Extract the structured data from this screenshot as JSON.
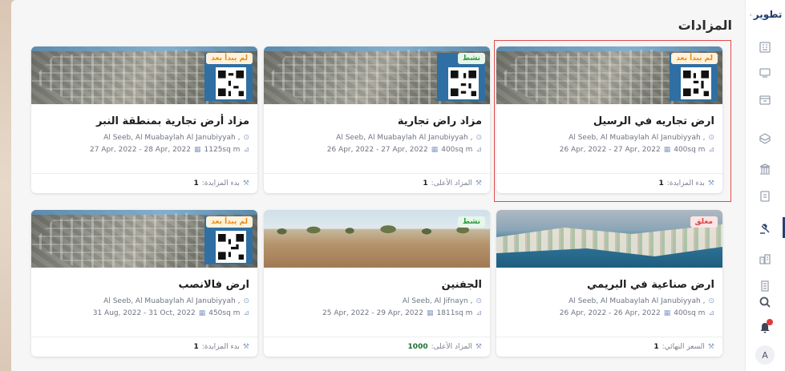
{
  "rail": {
    "brand": "تطوير",
    "notification_badge_color": "#e23b3b",
    "avatar_letter": "A",
    "icons": [
      "building-grid-icon",
      "monitor-icon",
      "screen-icon",
      "cube-icon",
      "bank-icon",
      "document-icon",
      "gavel-icon",
      "city-icon",
      "tower-icon",
      "search-icon",
      "bell-icon"
    ]
  },
  "page": {
    "title": "المزادات"
  },
  "cards": [
    {
      "title": "ارض تجاريه في الرسيل",
      "location": "Al Seeb, Al Muabaylah Al Janubiyyah ,",
      "area": "400sq m",
      "dates": "26 Apr, 2022 - 27 Apr, 2022",
      "status": "لم يبدأ بعد",
      "foot_label": "بدء المزايدة:",
      "foot_value": "1"
    },
    {
      "title": "مزاد راض تجارية",
      "location": "Al Seeb, Al Muabaylah Al Janubiyyah ,",
      "area": "400sq m",
      "dates": "26 Apr, 2022 - 27 Apr, 2022",
      "status": "نشط",
      "foot_label": "المزاد الأعلى:",
      "foot_value": "1"
    },
    {
      "title": "مزاد أرض تجارية بمنطقة النبر",
      "location": "Al Seeb, Al Muabaylah Al Janubiyyah ,",
      "area": "1125sq m",
      "dates": "27 Apr, 2022 - 28 Apr, 2022",
      "status": "لم يبدأ بعد",
      "foot_label": "بدء المزايدة:",
      "foot_value": "1"
    },
    {
      "title": "ارض صناعية في البريمي",
      "location": "Al Seeb, Al Muabaylah Al Janubiyyah ,",
      "area": "400sq m",
      "dates": "26 Apr, 2022 - 26 Apr, 2022",
      "status": "مغلق",
      "foot_label": "السعر النهائي:",
      "foot_value": "1"
    },
    {
      "title": "الجفنين",
      "location": "Al Seeb, Al Jifnayn ,",
      "area": "1811sq m",
      "dates": "25 Apr, 2022 - 29 Apr, 2022",
      "status": "نشط",
      "foot_label": "المزاد الأعلى:",
      "foot_value": "1000"
    },
    {
      "title": "ارض فالانصب",
      "location": "Al Seeb, Al Muabaylah Al Janubiyyah ,",
      "area": "450sq m",
      "dates": "31 Aug, 2022 - 31 Oct, 2022",
      "status": "لم يبدأ بعد",
      "foot_label": "بدء المزايدة:",
      "foot_value": "1"
    }
  ],
  "colors": {
    "status_not_started": "#f08a0c",
    "status_active": "#2e9a44",
    "status_closed": "#d64545",
    "selection_outline": "#e24a4a"
  }
}
